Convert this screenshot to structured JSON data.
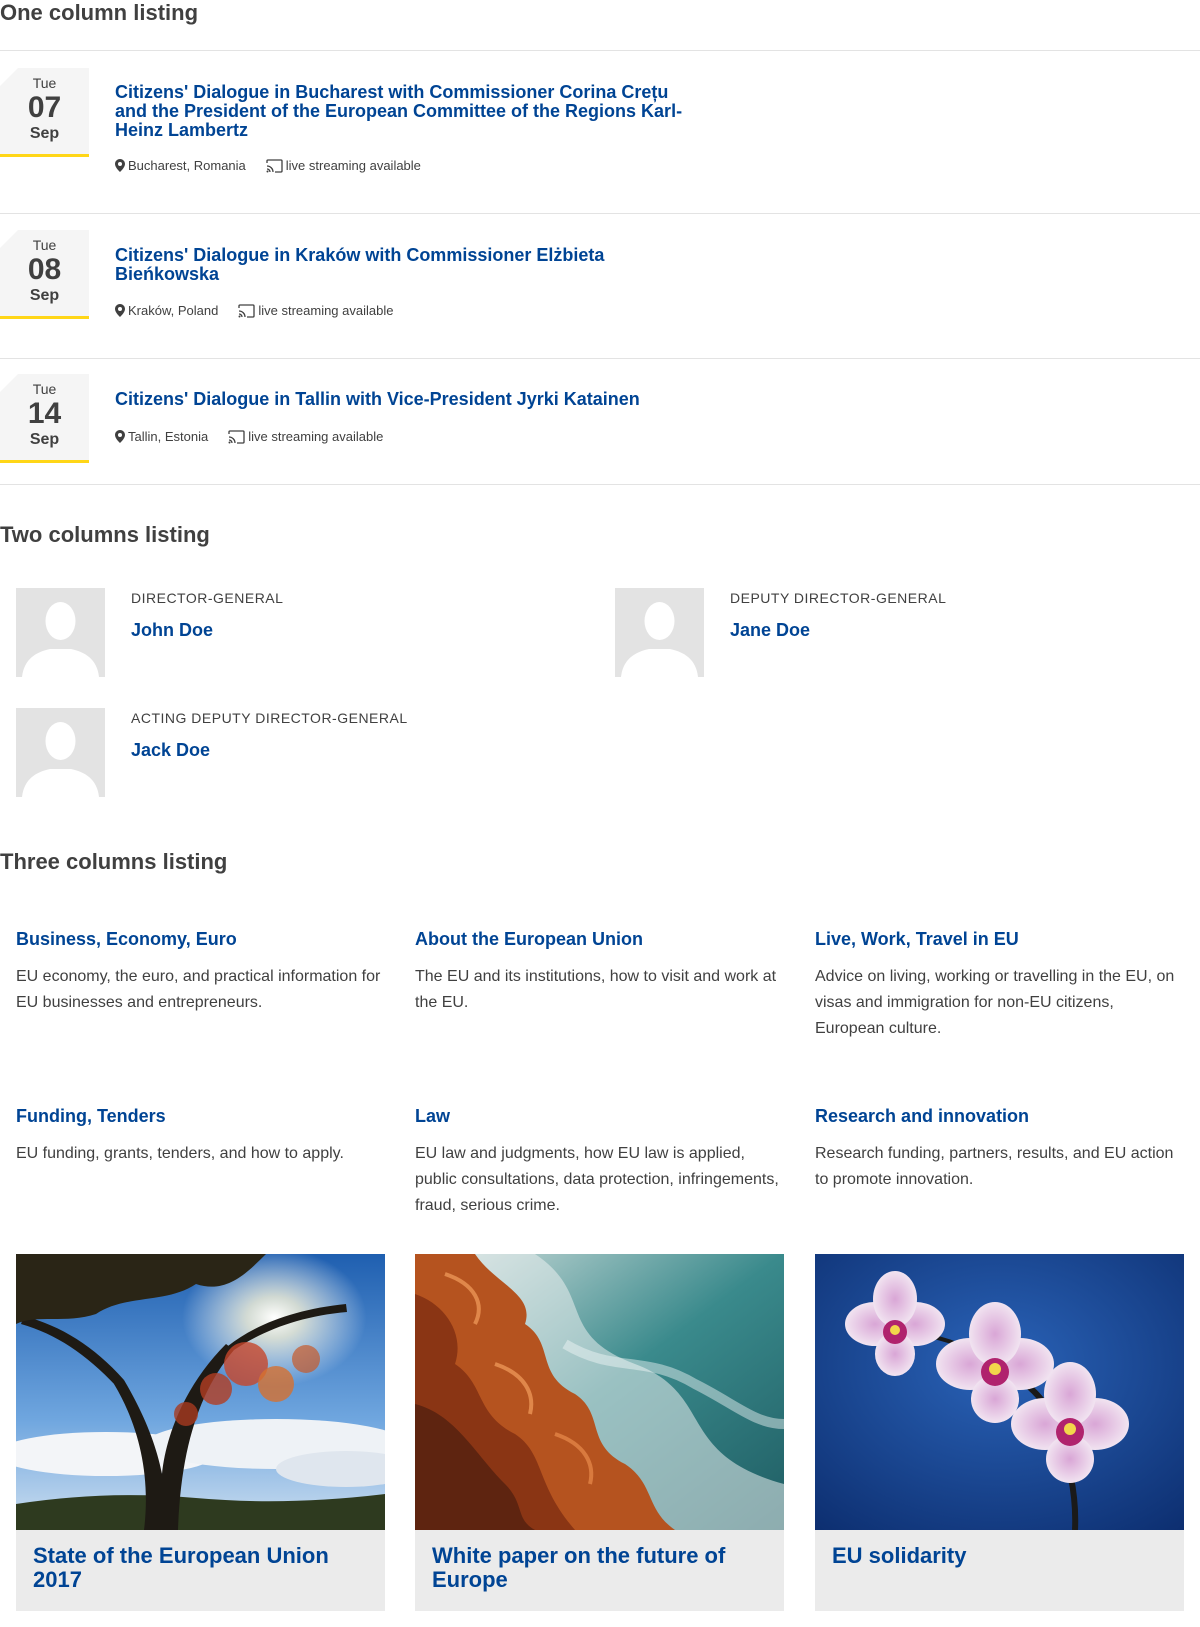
{
  "sections": {
    "one_column": "One column listing",
    "two_columns": "Two columns listing",
    "three_columns": "Three columns listing"
  },
  "events": [
    {
      "dow": "Tue",
      "day": "07",
      "month": "Sep",
      "title": "Citizens' Dialogue in Bucharest with Commissioner Corina Crețu and the President of the European Committee of the Regions Karl-Heinz Lambertz",
      "location": "Bucharest, Romania",
      "streaming": "live streaming available"
    },
    {
      "dow": "Tue",
      "day": "08",
      "month": "Sep",
      "title": "Citizens' Dialogue in Kraków with Commissioner Elżbieta Bieńkowska",
      "location": "Kraków, Poland",
      "streaming": "live streaming available"
    },
    {
      "dow": "Tue",
      "day": "14",
      "month": "Sep",
      "title": "Citizens' Dialogue in Tallin with Vice-President Jyrki Katainen",
      "location": "Tallin, Estonia",
      "streaming": "live streaming available"
    }
  ],
  "people": [
    {
      "role": "DIRECTOR-GENERAL",
      "name": "John Doe"
    },
    {
      "role": "DEPUTY DIRECTOR-GENERAL",
      "name": "Jane Doe"
    },
    {
      "role": "ACTING DEPUTY DIRECTOR-GENERAL",
      "name": "Jack Doe"
    }
  ],
  "topics": [
    {
      "title": "Business, Economy, Euro",
      "desc": "EU economy, the euro, and practical information for EU businesses and entrepreneurs."
    },
    {
      "title": "About the European Union",
      "desc": "The EU and its institutions, how to visit and work at the EU."
    },
    {
      "title": "Live, Work, Travel in EU",
      "desc": "Advice on living, working or travelling in the EU, on visas and immigration for non-EU citizens, European culture."
    },
    {
      "title": "Funding, Tenders",
      "desc": "EU funding, grants, tenders, and how to apply."
    },
    {
      "title": "Law",
      "desc": "EU law and judgments, how EU law is applied, public consultations, data protection, infringements, fraud, serious crime."
    },
    {
      "title": "Research and innovation",
      "desc": "Research funding, partners, results, and EU action to promote innovation."
    }
  ],
  "cards": [
    {
      "title": "State of the European Union 2017",
      "image": "tree-sky-photo"
    },
    {
      "title": "White paper on the future of Europe",
      "image": "coast-photo"
    },
    {
      "title": "EU solidarity",
      "image": "orchid-photo"
    }
  ],
  "colors": {
    "link": "#004494",
    "accent": "#ffd617",
    "text": "#404040",
    "border": "#e3e3e3"
  }
}
